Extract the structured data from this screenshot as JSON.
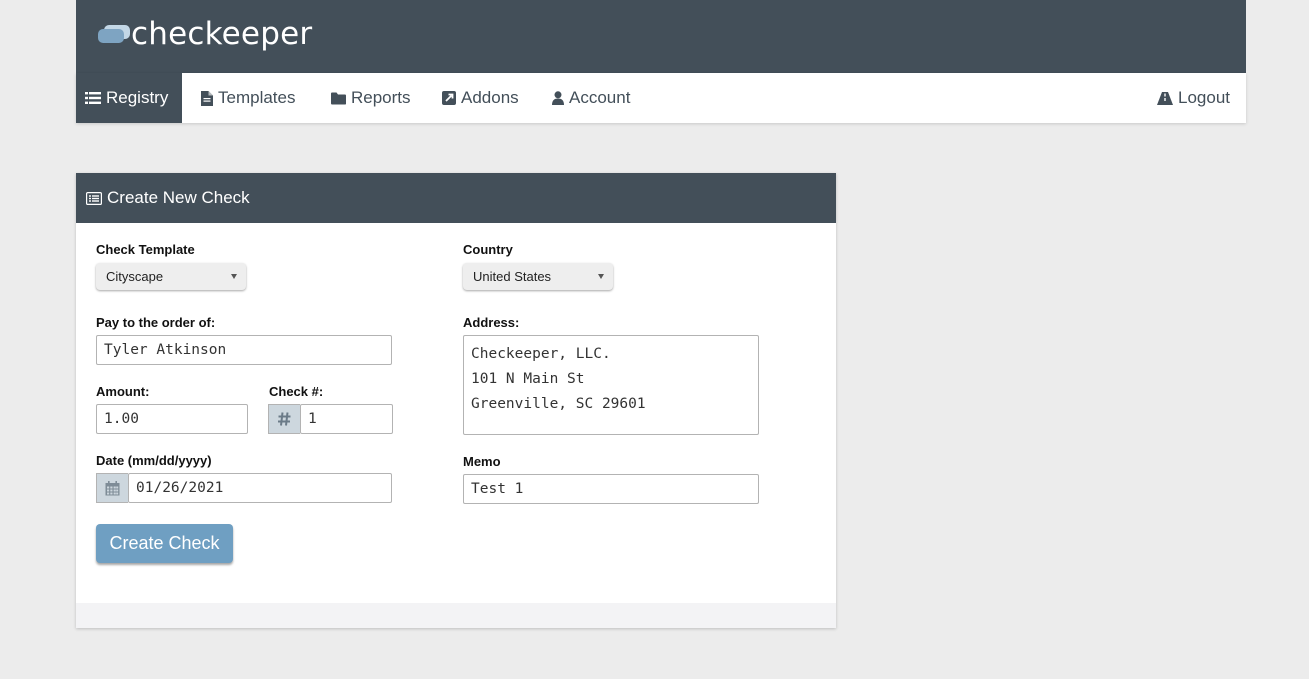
{
  "brand": {
    "name": "checkeeper"
  },
  "nav": {
    "registry": "Registry",
    "templates": "Templates",
    "reports": "Reports",
    "addons": "Addons",
    "account": "Account",
    "logout": "Logout"
  },
  "panel": {
    "title": "Create New Check"
  },
  "form": {
    "template_label": "Check Template",
    "template_value": "Cityscape",
    "country_label": "Country",
    "country_value": "United States",
    "payee_label": "Pay to the order of:",
    "payee_value": "Tyler Atkinson",
    "address_label": "Address:",
    "address_lines": [
      "Checkeeper, LLC.",
      "101 N Main St",
      "Greenville, SC 29601"
    ],
    "amount_label": "Amount:",
    "amount_value": "1.00",
    "checknum_label": "Check #:",
    "checknum_value": "1",
    "date_label": "Date (mm/dd/yyyy)",
    "date_value": "01/26/2021",
    "memo_label": "Memo",
    "memo_value": "Test 1",
    "submit_label": "Create Check"
  },
  "icons": {
    "logo": "checkeeper-logo-icon",
    "registry": "list-icon",
    "templates": "file-icon",
    "reports": "folder-icon",
    "addons": "external-link-icon",
    "account": "user-icon",
    "logout": "road-icon",
    "panel": "list-alt-icon",
    "checknum": "hash-icon",
    "date": "calendar-icon"
  },
  "colors": {
    "header": "#434f59",
    "accent": "#6f9fc2",
    "background": "#ececec"
  }
}
